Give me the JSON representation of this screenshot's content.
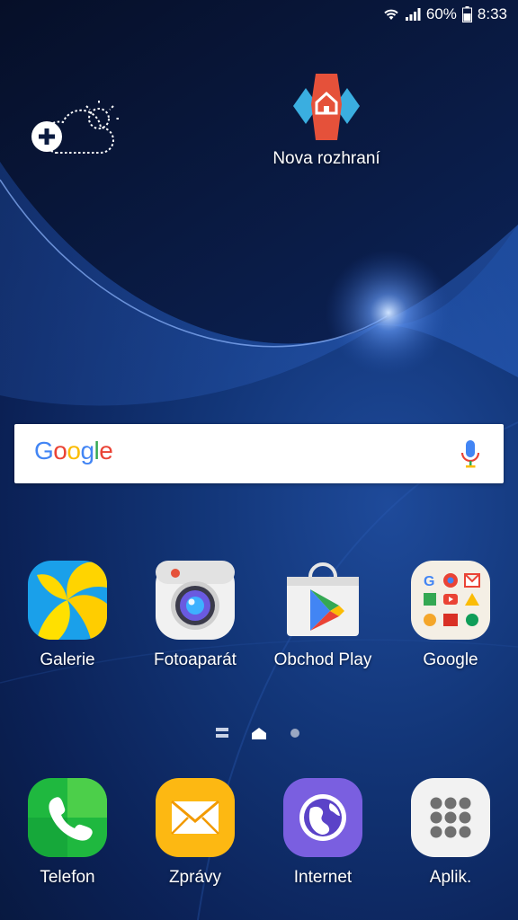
{
  "status_bar": {
    "battery": "60%",
    "time": "8:33"
  },
  "shortcut": {
    "label": "Nova rozhraní"
  },
  "search_bar": {
    "logo_letters": [
      {
        "ch": "G",
        "color": "#4285F4"
      },
      {
        "ch": "o",
        "color": "#EA4335"
      },
      {
        "ch": "o",
        "color": "#FBBC05"
      },
      {
        "ch": "g",
        "color": "#4285F4"
      },
      {
        "ch": "l",
        "color": "#34A853"
      },
      {
        "ch": "e",
        "color": "#EA4335"
      }
    ]
  },
  "home_apps": [
    {
      "label": "Galerie",
      "icon": "gallery-icon"
    },
    {
      "label": "Fotoaparát",
      "icon": "camera-icon"
    },
    {
      "label": "Obchod Play",
      "icon": "play-store-icon"
    },
    {
      "label": "Google",
      "icon": "google-folder-icon"
    }
  ],
  "dock_apps": [
    {
      "label": "Telefon",
      "icon": "phone-icon"
    },
    {
      "label": "Zprávy",
      "icon": "messages-icon"
    },
    {
      "label": "Internet",
      "icon": "internet-icon"
    },
    {
      "label": "Aplik.",
      "icon": "apps-icon"
    }
  ],
  "colors": {
    "wallpaper_dark": "#071638",
    "wallpaper_light": "#1e4a9a",
    "nova_red": "#E5513A",
    "nova_blue": "#3AAEE0"
  }
}
